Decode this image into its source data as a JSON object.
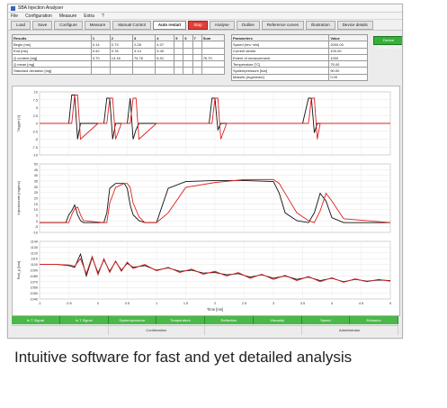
{
  "window": {
    "title": "SBA Injection Analyser"
  },
  "menu": [
    "File",
    "Configuration",
    "Measure",
    "Extra",
    "?"
  ],
  "toolbar": [
    {
      "label": "Load",
      "state": "normal"
    },
    {
      "label": "Save",
      "state": "normal"
    },
    {
      "label": "Configure",
      "state": "normal"
    },
    {
      "label": "Measure",
      "state": "normal"
    },
    {
      "label": "Manual Control",
      "state": "normal"
    },
    {
      "label": "Auto restart",
      "state": "active"
    },
    {
      "label": "Stop",
      "state": "stop"
    },
    {
      "label": "Analyse",
      "state": "normal"
    },
    {
      "label": "Outline",
      "state": "normal"
    },
    {
      "label": "Reference curves",
      "state": "normal"
    },
    {
      "label": "Illustration",
      "state": "normal"
    },
    {
      "label": "Device details",
      "state": "normal"
    }
  ],
  "status_indicator": "Device CONNECTED",
  "results": {
    "header": [
      "Results",
      "1",
      "2",
      "3",
      "4",
      "5",
      "6",
      "7",
      "Sum"
    ],
    "rows": [
      [
        "Begin [ms]",
        "0.14",
        "0.73",
        "2.28",
        "4.07",
        "",
        "",
        "",
        ""
      ],
      [
        "End [ms]",
        "0.42",
        "0.78",
        "4.14",
        "5.40",
        "",
        "",
        "",
        ""
      ],
      [
        "Q content [mg]",
        "3.70",
        "13.18",
        "76.76",
        "8.91",
        "",
        "",
        "",
        "76.70"
      ],
      [
        "Q mean [mg]",
        "",
        "",
        "",
        "",
        "",
        "",
        "",
        ""
      ],
      [
        "Standard deviation [mg]",
        "",
        "",
        "",
        "",
        "",
        "",
        "",
        ""
      ]
    ]
  },
  "parameters": {
    "header": [
      "Parameters",
      "Value"
    ],
    "rows": [
      [
        "Speed [rev/ min]",
        "2000.00"
      ],
      [
        "Current stroke",
        "100.00"
      ],
      [
        "Extent of measurement",
        "1000"
      ],
      [
        "Temperature [°C]",
        "75.00"
      ],
      [
        "Systempressure [bar]",
        "90.00"
      ],
      [
        "Massflo [mg/stroke]",
        "0.00"
      ]
    ]
  },
  "chart_data": [
    {
      "type": "line",
      "title": "",
      "ylabel": "Trigger [V]",
      "xlabel": "",
      "ylim": [
        -10,
        10
      ],
      "yticks": [
        "10",
        "7.5",
        "5",
        "2.5",
        "0",
        "-2.5",
        "-5",
        "-7.5",
        "-10"
      ],
      "x": [
        -1,
        -0.6,
        -0.5,
        -0.45,
        -0.4,
        -0.35,
        -0.3,
        0,
        0.1,
        0.15,
        0.2,
        0.25,
        0.3,
        0.4,
        0.5,
        0.55,
        0.6,
        0.65,
        0.7,
        1.0,
        1.9,
        1.95,
        2.0,
        2.05,
        2.1,
        2.2,
        3.5,
        3.6,
        3.65,
        3.7,
        3.75,
        3.8,
        4.0,
        4.1,
        4.2,
        4.3,
        4.4,
        5.0
      ],
      "series": [
        {
          "color": "#111111",
          "values": [
            0,
            0,
            0,
            9,
            9,
            -5,
            0,
            0,
            0,
            8,
            8,
            -5,
            0,
            0,
            0,
            8,
            -5,
            -2,
            0,
            0,
            0,
            8,
            8,
            -2,
            0,
            0,
            0,
            8,
            8,
            -3,
            0,
            0,
            0,
            0,
            0,
            0,
            0,
            0
          ]
        },
        {
          "color": "#e02020",
          "values": [
            0,
            0,
            0,
            0,
            9,
            9,
            -5,
            0,
            0,
            0,
            8,
            8,
            -5,
            0,
            0,
            0,
            8,
            8,
            -5,
            0,
            0,
            0,
            8,
            8,
            -5,
            0,
            0,
            0,
            8,
            8,
            -5,
            0,
            0,
            0,
            0,
            0,
            0,
            0
          ]
        }
      ]
    },
    {
      "type": "line",
      "title": "",
      "ylabel": "Injectionrate [mg/ms]",
      "xlabel": "",
      "ylim": [
        -10,
        60
      ],
      "yticks": [
        "50",
        "45",
        "40",
        "35",
        "30",
        "25",
        "20",
        "15",
        "10",
        "5",
        "0",
        "-5",
        "-10"
      ],
      "x": [
        -1,
        -0.55,
        -0.5,
        -0.45,
        -0.4,
        -0.35,
        -0.3,
        -0.25,
        0.1,
        0.15,
        0.2,
        0.3,
        0.45,
        0.5,
        0.55,
        0.6,
        0.7,
        0.8,
        1.0,
        1.2,
        1.5,
        2.0,
        2.5,
        3.0,
        3.1,
        3.2,
        3.4,
        3.6,
        3.7,
        3.8,
        3.9,
        4.0,
        4.2,
        5.0
      ],
      "series": [
        {
          "color": "#111111",
          "values": [
            0,
            0,
            8,
            12,
            18,
            8,
            2,
            0,
            0,
            10,
            35,
            40,
            40,
            35,
            18,
            8,
            2,
            0,
            0,
            35,
            42,
            43,
            43,
            42,
            30,
            10,
            2,
            0,
            10,
            30,
            22,
            5,
            0,
            0
          ]
        },
        {
          "color": "#e02020",
          "values": [
            0,
            0,
            0,
            8,
            14,
            16,
            8,
            2,
            0,
            0,
            20,
            36,
            40,
            40,
            36,
            20,
            6,
            0,
            0,
            10,
            36,
            41,
            44,
            44,
            40,
            30,
            10,
            2,
            0,
            12,
            30,
            22,
            4,
            0
          ]
        }
      ]
    },
    {
      "type": "line",
      "title": "",
      "ylabel": "Rail_p [bar]",
      "xlabel": "Time [ms]",
      "ylim": [
        1040,
        1140
      ],
      "yticks": [
        "1140",
        "1130",
        "1120",
        "1110",
        "1100",
        "1090",
        "1080",
        "1070",
        "1060",
        "1050",
        "1040"
      ],
      "xticks": [
        "-1",
        "-0.5",
        "0",
        "0.5",
        "1",
        "1.5",
        "2",
        "2.5",
        "3",
        "3.5",
        "4",
        "4.5",
        "5"
      ],
      "x": [
        -1,
        -0.7,
        -0.5,
        -0.4,
        -0.3,
        -0.2,
        -0.1,
        0,
        0.1,
        0.2,
        0.3,
        0.4,
        0.5,
        0.6,
        0.8,
        1.0,
        1.2,
        1.4,
        1.6,
        1.8,
        2.0,
        2.2,
        2.4,
        2.6,
        2.8,
        3.0,
        3.2,
        3.4,
        3.6,
        3.8,
        4.0,
        4.2,
        4.4,
        4.6,
        4.8,
        5.0
      ],
      "series": [
        {
          "color": "#111111",
          "values": [
            1100,
            1100,
            1098,
            1095,
            1118,
            1080,
            1112,
            1085,
            1108,
            1088,
            1105,
            1090,
            1102,
            1095,
            1098,
            1090,
            1094,
            1088,
            1090,
            1085,
            1086,
            1082,
            1084,
            1078,
            1082,
            1076,
            1080,
            1074,
            1078,
            1072,
            1076,
            1070,
            1074,
            1071,
            1073,
            1072
          ]
        },
        {
          "color": "#e02020",
          "values": [
            1100,
            1100,
            1099,
            1097,
            1110,
            1084,
            1114,
            1082,
            1110,
            1086,
            1106,
            1088,
            1104,
            1093,
            1100,
            1089,
            1095,
            1086,
            1092,
            1083,
            1088,
            1080,
            1086,
            1076,
            1083,
            1074,
            1081,
            1072,
            1079,
            1070,
            1077,
            1069,
            1075,
            1070,
            1074,
            1071
          ]
        }
      ]
    }
  ],
  "bottom_tabs": [
    "In T Signal",
    "In T Signal",
    "Systempressure",
    "Temperature",
    "Reflection",
    "Viscosity",
    "Speed",
    "Emission"
  ],
  "status_cells": [
    "",
    "Confirmation",
    "",
    "Administrator"
  ],
  "caption": "Intuitive software for fast and yet detailed analysis"
}
